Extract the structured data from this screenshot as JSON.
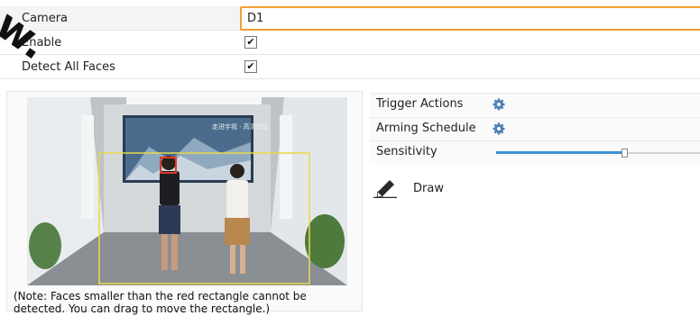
{
  "form": {
    "camera_label": "Camera",
    "camera_value": "D1",
    "enable_label": "Enable",
    "enable_checked": true,
    "detect_all_faces_label": "Detect All Faces",
    "detect_all_faces_checked": true
  },
  "check_glyph": "✔",
  "settings": {
    "trigger_actions_label": "Trigger Actions",
    "arming_schedule_label": "Arming Schedule",
    "sensitivity_label": "Sensitivity",
    "sensitivity_level": 0.59,
    "draw_label": "Draw"
  },
  "preview": {
    "screen_caption": "走进宇视 · 高清图像",
    "note_line1": "(Note: Faces smaller than the red rectangle cannot be",
    "note_line2": "detected. You can drag to move the rectangle.)"
  },
  "watermark": "w.",
  "colors": {
    "accent_border": "#f0a030",
    "detection_area": "#e8d94a",
    "face_rect": "#e03a2a",
    "slider_fill": "#3a8fd6"
  }
}
